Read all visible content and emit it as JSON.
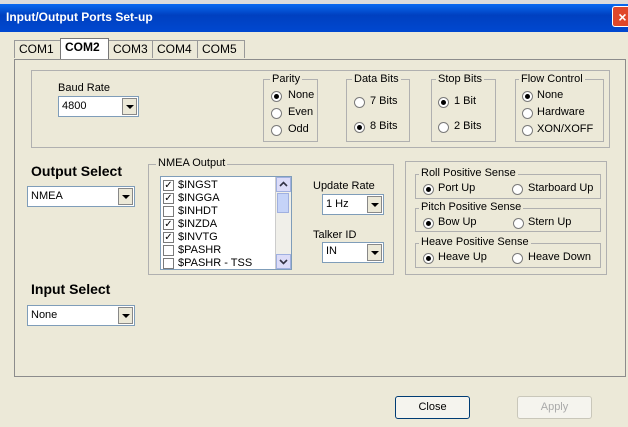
{
  "window": {
    "title": "Input/Output Ports Set-up",
    "close_glyph": "×"
  },
  "tabs": [
    "COM1",
    "COM2",
    "COM3",
    "COM4",
    "COM5"
  ],
  "active_tab": "COM2",
  "baud": {
    "label": "Baud Rate",
    "value": "4800"
  },
  "parity": {
    "label": "Parity",
    "options": [
      "None",
      "Even",
      "Odd"
    ],
    "selected": "None"
  },
  "data_bits": {
    "label": "Data Bits",
    "options": [
      "7 Bits",
      "8 Bits"
    ],
    "selected": "8 Bits"
  },
  "stop_bits": {
    "label": "Stop Bits",
    "options": [
      "1 Bit",
      "2 Bits"
    ],
    "selected": "1 Bit"
  },
  "flow": {
    "label": "Flow Control",
    "options": [
      "None",
      "Hardware",
      "XON/XOFF"
    ],
    "selected": "None"
  },
  "output_select": {
    "label": "Output Select",
    "value": "NMEA"
  },
  "nmea": {
    "label": "NMEA Output",
    "items": [
      {
        "text": "$INGST",
        "checked": true
      },
      {
        "text": "$INGGA",
        "checked": true
      },
      {
        "text": "$INHDT",
        "checked": false
      },
      {
        "text": "$INZDA",
        "checked": true
      },
      {
        "text": "$INVTG",
        "checked": true
      },
      {
        "text": "$PASHR",
        "checked": false
      },
      {
        "text": "$PASHR - TSS",
        "checked": false
      }
    ]
  },
  "update_rate": {
    "label": "Update Rate",
    "value": "1 Hz"
  },
  "talker_id": {
    "label": "Talker ID",
    "value": "IN"
  },
  "roll": {
    "label": "Roll Positive Sense",
    "options": [
      "Port Up",
      "Starboard Up"
    ],
    "selected": "Port Up"
  },
  "pitch": {
    "label": "Pitch Positive Sense",
    "options": [
      "Bow Up",
      "Stern Up"
    ],
    "selected": "Bow Up"
  },
  "heave": {
    "label": "Heave Positive Sense",
    "options": [
      "Heave Up",
      "Heave Down"
    ],
    "selected": "Heave Up"
  },
  "input_select": {
    "label": "Input Select",
    "value": "None"
  },
  "buttons": {
    "close": "Close",
    "apply": "Apply"
  },
  "colors": {
    "title_bar": "#0040c0",
    "dialog_bg": "#ece9d8",
    "close_red": "#e0472a"
  }
}
